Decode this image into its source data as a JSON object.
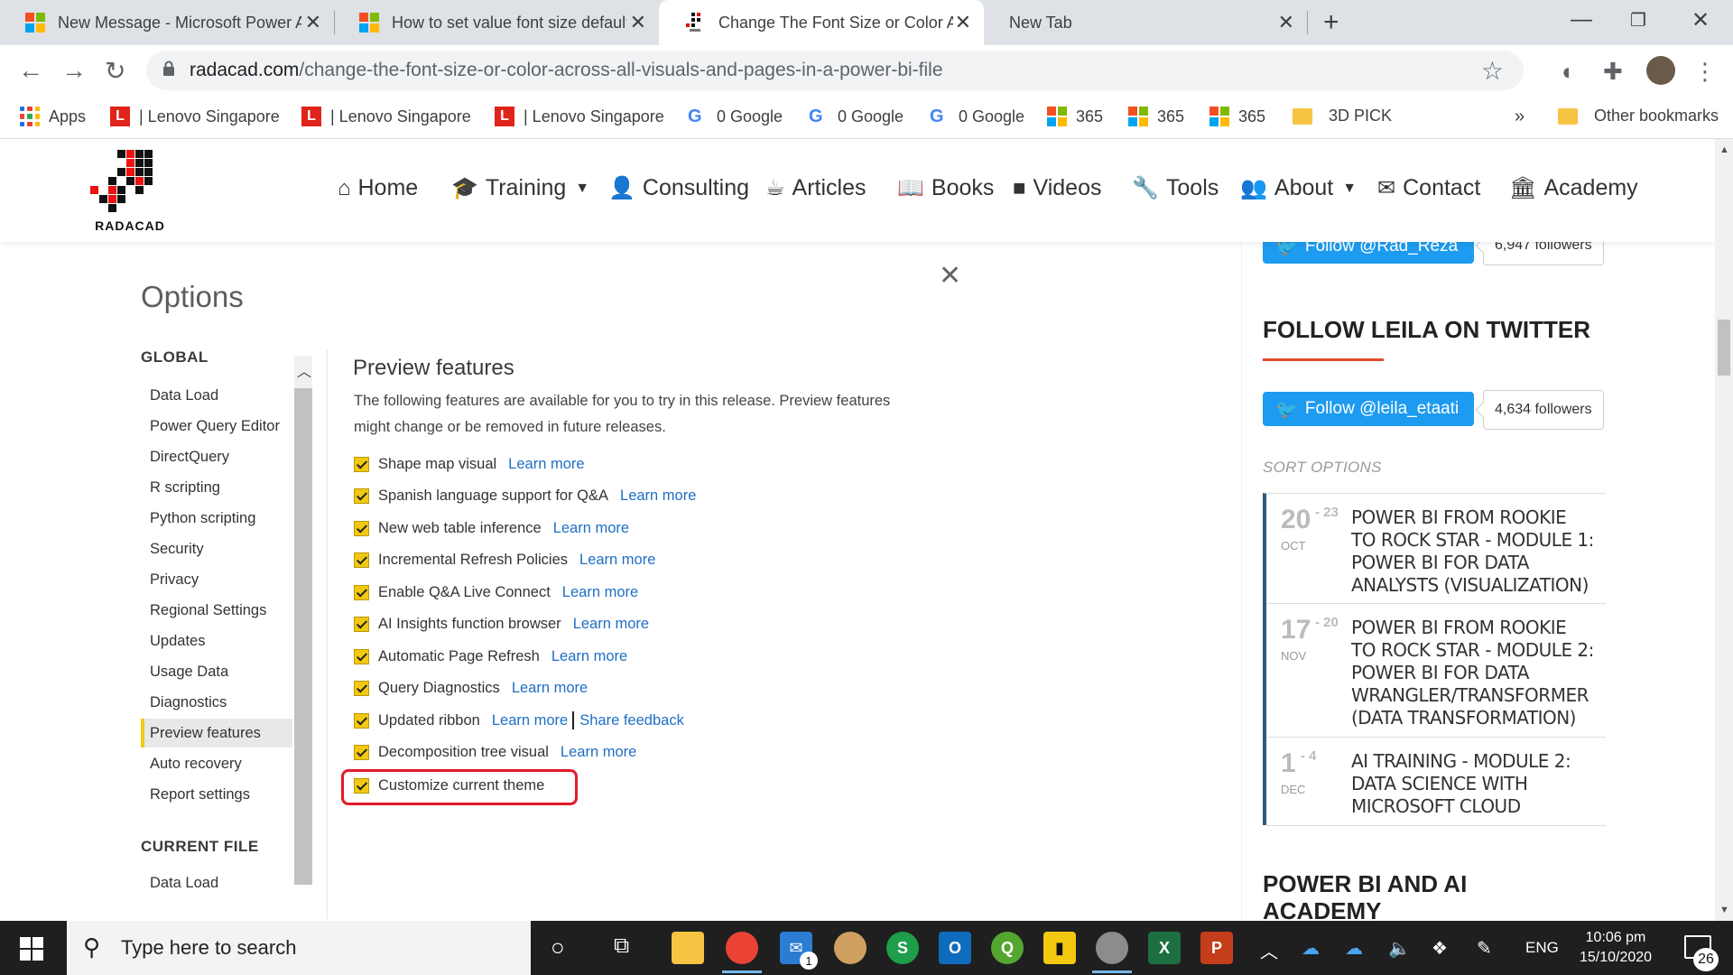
{
  "browser": {
    "tabs": [
      {
        "title": "New Message - Microsoft Power Automate",
        "icon": "microsoft-icon"
      },
      {
        "title": "How to set value font size default",
        "icon": "microsoft-icon"
      },
      {
        "title": "Change The Font Size or Color Across",
        "icon": "radacad-icon"
      },
      {
        "title": "New Tab",
        "icon": ""
      }
    ],
    "url_host": "radacad.com",
    "url_path": "/change-the-font-size-or-color-across-all-visuals-and-pages-in-a-power-bi-file",
    "bookmarks": [
      {
        "label": "Apps",
        "icon": "apps-grid-icon"
      },
      {
        "label": "| Lenovo Singapore",
        "icon": "lenovo-icon"
      },
      {
        "label": "| Lenovo Singapore",
        "icon": "lenovo-icon"
      },
      {
        "label": "| Lenovo Singapore",
        "icon": "lenovo-icon"
      },
      {
        "label": "0 Google",
        "icon": "google-icon"
      },
      {
        "label": "0 Google",
        "icon": "google-icon"
      },
      {
        "label": "0 Google",
        "icon": "google-icon"
      },
      {
        "label": "365",
        "icon": "microsoft-icon"
      },
      {
        "label": "365",
        "icon": "microsoft-icon"
      },
      {
        "label": "365",
        "icon": "microsoft-icon"
      },
      {
        "label": "3D PICK",
        "icon": "folder-icon"
      }
    ],
    "more_bookmarks": "»",
    "other_bookmarks": "Other bookmarks"
  },
  "site": {
    "logo_text": "RADACAD",
    "nav": [
      {
        "label": "Home",
        "icon": "home-icon"
      },
      {
        "label": "Training",
        "icon": "graduation-cap-icon",
        "dropdown": true
      },
      {
        "label": "Consulting",
        "icon": "user-icon"
      },
      {
        "label": "Articles",
        "icon": "coffee-icon"
      },
      {
        "label": "Books",
        "icon": "book-icon"
      },
      {
        "label": "Videos",
        "icon": "video-icon"
      },
      {
        "label": "Tools",
        "icon": "wrench-icon"
      },
      {
        "label": "About",
        "icon": "users-icon",
        "dropdown": true
      },
      {
        "label": "Contact",
        "icon": "envelope-icon"
      },
      {
        "label": "Academy",
        "icon": "institution-icon"
      }
    ]
  },
  "options": {
    "title": "Options",
    "global_heading": "GLOBAL",
    "global_items": [
      "Data Load",
      "Power Query Editor",
      "DirectQuery",
      "R scripting",
      "Python scripting",
      "Security",
      "Privacy",
      "Regional Settings",
      "Updates",
      "Usage Data",
      "Diagnostics",
      "Preview features",
      "Auto recovery",
      "Report settings"
    ],
    "selected_item": "Preview features",
    "current_file_heading": "CURRENT FILE",
    "current_file_items": [
      "Data Load"
    ],
    "preview_title": "Preview features",
    "preview_desc": "The following features are available for you to try in this release. Preview features might change or be removed in future releases.",
    "features": [
      {
        "label": "Shape map visual",
        "links": [
          "Learn more"
        ]
      },
      {
        "label": "Spanish language support for Q&A",
        "links": [
          "Learn more"
        ]
      },
      {
        "label": "New web table inference",
        "links": [
          "Learn more"
        ]
      },
      {
        "label": "Incremental Refresh Policies",
        "links": [
          "Learn more"
        ]
      },
      {
        "label": "Enable Q&A Live Connect",
        "links": [
          "Learn more"
        ]
      },
      {
        "label": "AI Insights function browser",
        "links": [
          "Learn more"
        ]
      },
      {
        "label": "Automatic Page Refresh",
        "links": [
          "Learn more"
        ]
      },
      {
        "label": "Query Diagnostics",
        "links": [
          "Learn more"
        ]
      },
      {
        "label": "Updated ribbon",
        "links": [
          "Learn more",
          "Share feedback"
        ]
      },
      {
        "label": "Decomposition tree visual",
        "links": [
          "Learn more"
        ]
      },
      {
        "label": "Customize current theme",
        "links": []
      }
    ],
    "highlight_color": "#e01b2a",
    "checkbox_color": "#f2c811"
  },
  "sidebar": {
    "reza_button": "Follow @Rad_Reza",
    "reza_followers": "6,947 followers",
    "leila_heading": "FOLLOW LEILA ON TWITTER",
    "leila_button": "Follow @leila_etaati",
    "leila_followers": "4,634 followers",
    "sort_options": "SORT OPTIONS",
    "events": [
      {
        "day": "20",
        "end": "- 23",
        "month": "OCT",
        "title": "POWER BI FROM ROOKIE TO ROCK STAR - MODULE 1: POWER BI FOR DATA ANALYSTS (VISUALIZATION)"
      },
      {
        "day": "17",
        "end": "- 20",
        "month": "NOV",
        "title": "POWER BI FROM ROOKIE TO ROCK STAR - MODULE 2: POWER BI FOR DATA WRANGLER/TRANSFORMER (DATA TRANSFORMATION)"
      },
      {
        "day": "1",
        "end": "- 4",
        "month": "DEC",
        "title": "AI TRAINING - MODULE 2: DATA SCIENCE WITH MICROSOFT CLOUD"
      }
    ],
    "academy_heading": "POWER BI AND AI ACADEMY"
  },
  "taskbar": {
    "search_placeholder": "Type here to search",
    "mail_badge": "1",
    "language": "ENG",
    "time": "10:06 pm",
    "date": "15/10/2020",
    "notifications": "26"
  }
}
